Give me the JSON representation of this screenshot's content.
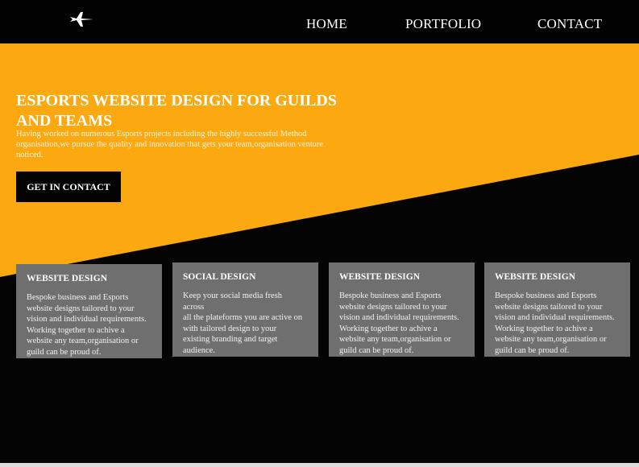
{
  "header": {
    "logo_icon": "plane-icon",
    "nav": [
      {
        "label": "HOME"
      },
      {
        "label": "PORTFOLIO"
      },
      {
        "label": "CONTACT"
      }
    ]
  },
  "hero": {
    "title": "ESPORTS WEBSITE DESIGN FOR GUILDS AND TEAMS",
    "description": "Having worked on numerous Esports projects including the highly successful Method organisation,we pursue the quality and innovation that gets your team,organisation venture noticed.",
    "cta_label": "GET IN CONTACT"
  },
  "cards": [
    {
      "title": "WEBSITE DESIGN",
      "text": "Bespoke business and Esports\nwebsite designs tailored to your\nvision and individual requirements.\nWorking together to achive a\nwebsite any team,organisation or\nguild can be proud of."
    },
    {
      "title": "SOCIAL DESIGN",
      "text": "Keep your social media fresh\nacross\nall the plateforms you are active on\nwith tailored design to your\nexisting branding and target\naudience."
    },
    {
      "title": "WEBSITE DESIGN",
      "text": "Bespoke business and Esports\nwebsite designs tailored to your\nvision and individual requirements.\nWorking together to achive a\nwebsite any team,organisation or\nguild can be proud of."
    },
    {
      "title": "WEBSITE DESIGN",
      "text": "Bespoke business and Esports\nwebsite designs tailored to your\nvision and individual requirements.\nWorking together to achive a\nwebsite any team,organisation or\nguild can be proud of."
    }
  ],
  "colors": {
    "accent": "#fca810",
    "background": "#040404",
    "card": "#6f6f6f"
  }
}
